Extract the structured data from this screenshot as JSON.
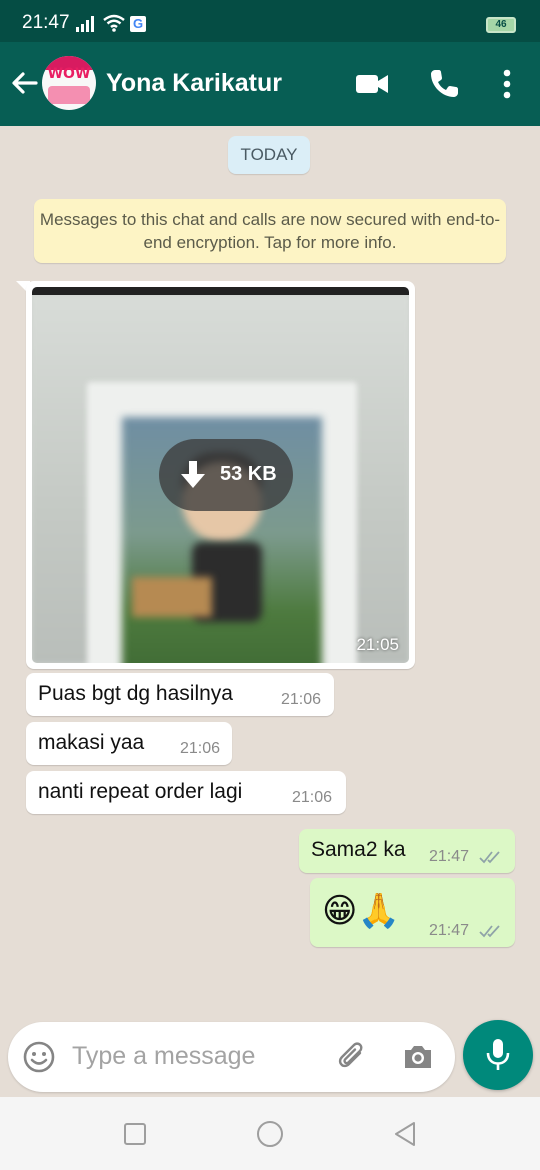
{
  "status_bar": {
    "time": "21:47",
    "battery": "46",
    "icons": [
      "signal-icon",
      "wifi-icon",
      "google-icon",
      "battery-icon"
    ]
  },
  "header": {
    "contact_name": "Yona Karikatur",
    "avatar_text": "WOW",
    "icons": [
      "back-arrow-icon",
      "video-call-icon",
      "voice-call-icon",
      "more-vertical-icon"
    ]
  },
  "chat": {
    "date_label": "TODAY",
    "encryption_notice": "Messages to this chat and calls are now secured with end-to-end encryption. Tap for more info.",
    "image_message": {
      "download_size": "53 KB",
      "time": "21:05"
    },
    "incoming": [
      {
        "text": "Puas bgt dg hasilnya",
        "time": "21:06"
      },
      {
        "text": "makasi yaa",
        "time": "21:06"
      },
      {
        "text": "nanti repeat order lagi",
        "time": "21:06"
      }
    ],
    "outgoing": [
      {
        "text": "Sama2 ka",
        "time": "21:47",
        "status": "read"
      },
      {
        "text": "😁🙏",
        "time": "21:47",
        "status": "read"
      }
    ]
  },
  "composer": {
    "placeholder": "Type a message",
    "icons": [
      "emoji-icon",
      "attach-icon",
      "camera-icon",
      "mic-icon"
    ]
  },
  "colors": {
    "header": "#075e54",
    "status_bar": "#054d44",
    "outgoing_bubble": "#dcf8c6",
    "incoming_bubble": "#ffffff",
    "accent": "#00897b",
    "tick_read": "#8fa3a8"
  }
}
